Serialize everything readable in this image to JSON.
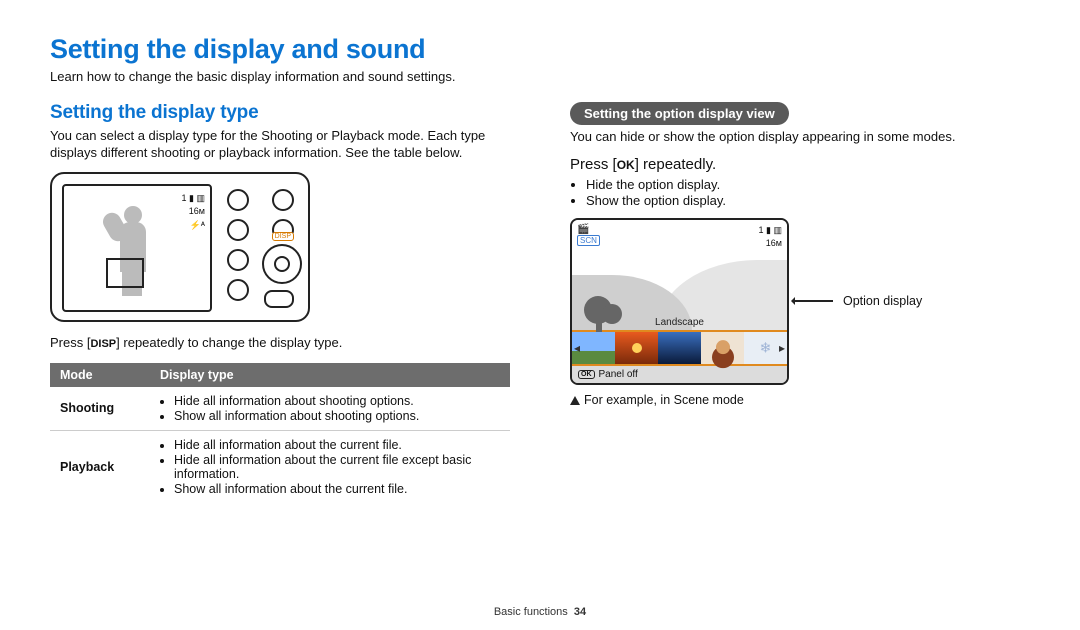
{
  "header": {
    "title": "Setting the display and sound",
    "intro": "Learn how to change the basic display information and sound settings."
  },
  "left": {
    "heading": "Setting the display type",
    "para": "You can select a display type for the Shooting or Playback mode. Each type displays different shooting or playback information. See the table below.",
    "camera": {
      "icon_battery": "1 ▮ ▥",
      "icon_mp": "16ᴍ",
      "icon_flash": "⚡ᴬ",
      "disp_label": "DISP"
    },
    "caption_pre": "Press [",
    "caption_chip": "DISP",
    "caption_post": "] repeatedly to change the display type.",
    "table": {
      "col1": "Mode",
      "col2": "Display type",
      "rows": [
        {
          "mode": "Shooting",
          "items": [
            "Hide all information about shooting options.",
            "Show all information about shooting options."
          ]
        },
        {
          "mode": "Playback",
          "items": [
            "Hide all information about the current file.",
            "Hide all information about the current file except basic information.",
            "Show all information about the current file."
          ]
        }
      ]
    }
  },
  "right": {
    "pill": "Setting the option display view",
    "para": "You can hide or show the option display appearing in some modes.",
    "press_pre": "Press [",
    "press_chip": "OK",
    "press_post": "] repeatedly.",
    "bullets": [
      "Hide the option display.",
      "Show the option display."
    ],
    "lcd": {
      "scn": "SCN",
      "film": "🎬",
      "tr_battery": "1 ▮ ▥",
      "tr_mp": "16ᴍ",
      "landscape": "Landscape",
      "ok_mini": "OK",
      "panel_off": "Panel off"
    },
    "opt_label": "Option display",
    "example": "For example, in Scene mode"
  },
  "footer": {
    "section": "Basic functions",
    "page": "34"
  }
}
